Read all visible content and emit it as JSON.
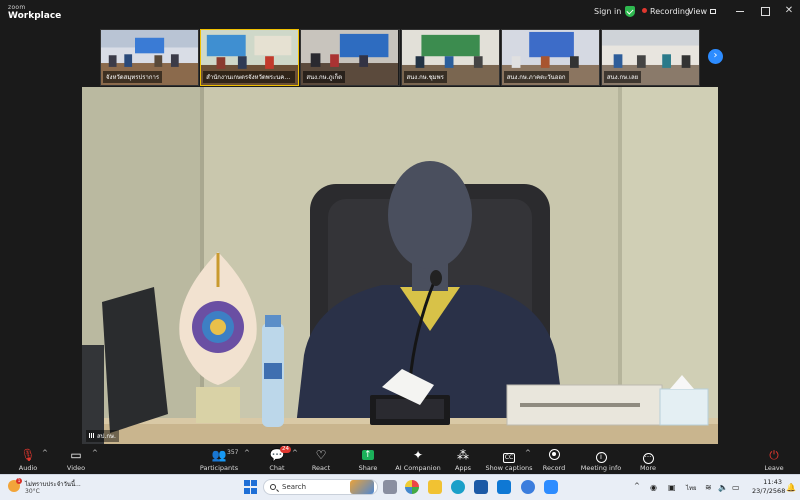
{
  "app": {
    "brand_small": "zoom",
    "brand_name": "Workplace"
  },
  "titlebar": {
    "sign_in": "Sign in",
    "recording": "Recording",
    "view": "View"
  },
  "gallery": {
    "tiles": [
      {
        "label": "จังหวัดสมุทรปราการ",
        "active": false
      },
      {
        "label": "สำนักงานเกษตรจังหวัดพระนครศรีอยุธยา",
        "active": true
      },
      {
        "label": "สนง.กษ.ภูเก็ต",
        "active": false
      },
      {
        "label": "สนง.กษ.ชุมพร",
        "active": false
      },
      {
        "label": "สนง.กษ.ภาคตะวันออก",
        "active": false
      },
      {
        "label": "สนง.กษ.เลย",
        "active": false
      }
    ]
  },
  "main_video": {
    "participant_name": "สป.กษ."
  },
  "toolbar": {
    "audio": "Audio",
    "video": "Video",
    "participants": "Participants",
    "participants_count": "357",
    "chat": "Chat",
    "chat_badge": "24",
    "react": "React",
    "share": "Share",
    "ai_companion": "AI Companion",
    "apps": "Apps",
    "show_captions": "Show captions",
    "record": "Record",
    "meeting_info": "Meeting info",
    "more": "More",
    "leave": "Leave"
  },
  "taskbar": {
    "weather_text": "ไม่ทราบประจำวันนี้...",
    "temperature": "30°C",
    "search_placeholder": "Search",
    "language": "ไทย",
    "time": "11:43",
    "date": "23/7/2568",
    "weather_badge": "1"
  },
  "colors": {
    "accent": "#2d8cff",
    "share_green": "#1bb05a",
    "recording_red": "#e0372f"
  }
}
